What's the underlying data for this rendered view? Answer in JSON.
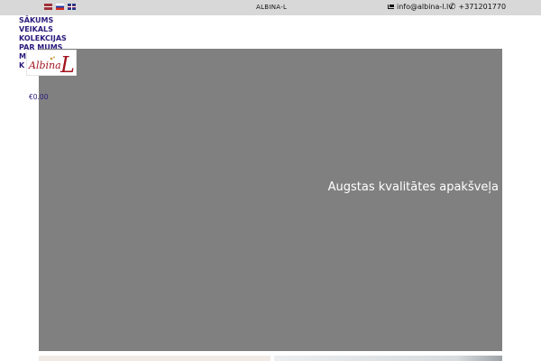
{
  "topbar": {
    "brand": "ALBINA-L",
    "email": "info@albina-l.lv",
    "phone": "+371201770",
    "icons": [
      "latvia-flag-icon",
      "russia-flag-icon",
      "uk-flag-icon",
      "envelope-icon",
      "phone-icon"
    ]
  },
  "nav": {
    "items": [
      "SĀKUMS",
      "VEIKALS",
      "KOLEKCIJAS",
      "PAR MUMS",
      "M",
      "K"
    ]
  },
  "logo": {
    "text": "Albina L"
  },
  "cart": {
    "total": "€0.00"
  },
  "hero": {
    "title": "Augstas kvalitātes apakšveļa"
  },
  "colors": {
    "topbar": "#d8d8d8",
    "nav_text": "#2a1a7c",
    "hero_bg": "#808080",
    "logo_red": "#a3121f"
  }
}
